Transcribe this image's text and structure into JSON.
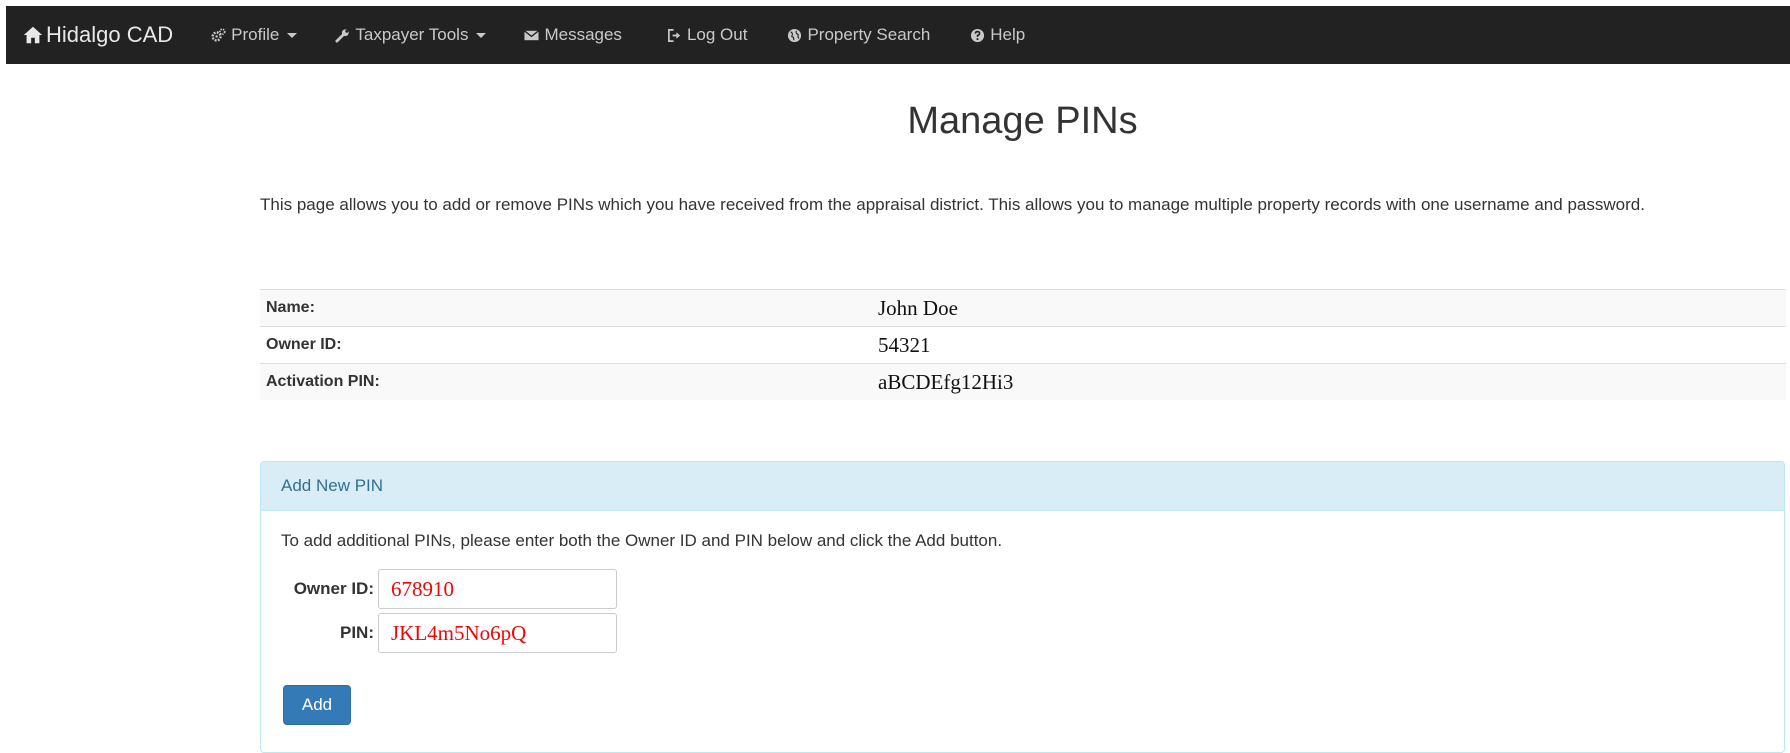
{
  "navbar": {
    "brand": "Hidalgo CAD",
    "brand_icon": "home-icon",
    "items": [
      {
        "label": "Profile",
        "icon": "cogs-icon",
        "dropdown": true
      },
      {
        "label": "Taxpayer Tools",
        "icon": "wrench-icon",
        "dropdown": true
      },
      {
        "label": "Messages",
        "icon": "envelope-icon",
        "dropdown": false
      },
      {
        "label": "Log Out",
        "icon": "log-out-icon",
        "dropdown": false
      },
      {
        "label": "Property Search",
        "icon": "globe-icon",
        "dropdown": false
      },
      {
        "label": "Help",
        "icon": "question-circle-icon",
        "dropdown": false
      }
    ]
  },
  "page": {
    "title": "Manage PINs",
    "intro": "This page allows you to add or remove PINs which you have received from the appraisal district. This allows you to manage multiple property records with one username and password."
  },
  "info": {
    "name_label": "Name:",
    "name_value": "John Doe",
    "owner_id_label": "Owner ID:",
    "owner_id_value": "54321",
    "pin_label": "Activation PIN:",
    "pin_value": "aBCDEfg12Hi3"
  },
  "add_pin": {
    "heading": "Add New PIN",
    "instructions": "To add additional PINs, please enter both the Owner ID and PIN below and click the Add button.",
    "owner_id_label": "Owner ID:",
    "owner_id_value": "678910",
    "pin_label": "PIN:",
    "pin_value": "JKL4m5No6pQ",
    "button_label": "Add"
  },
  "colors": {
    "navbar_bg": "#222222",
    "heading_bg": "#d9edf7",
    "heading_text": "#31708f",
    "button_bg": "#337ab7",
    "input_text": "#ff0000"
  }
}
